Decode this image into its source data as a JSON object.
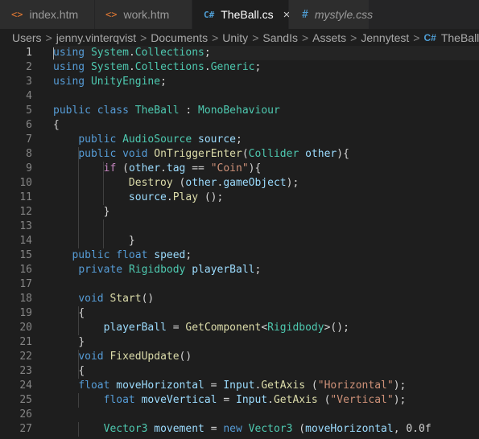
{
  "tabs": [
    {
      "icon": "<>",
      "label": "index.htm"
    },
    {
      "icon": "<>",
      "label": "work.htm"
    },
    {
      "icon": "C#",
      "label": "TheBall.cs",
      "close": "×"
    },
    {
      "icon": "#",
      "label": "mystyle.css"
    }
  ],
  "breadcrumb": {
    "items": [
      "Users",
      "jenny.vinterqvist",
      "Documents",
      "Unity",
      "SandIs",
      "Assets",
      "Jennytest"
    ],
    "file": "TheBall.cs"
  },
  "editor": {
    "line_numbers": [
      "1",
      "2",
      "3",
      "4",
      "5",
      "6",
      "7",
      "8",
      "9",
      "10",
      "11",
      "12",
      "13",
      "14",
      "15",
      "16",
      "17",
      "18",
      "19",
      "20",
      "21",
      "22",
      "23",
      "24",
      "25",
      "26",
      "27"
    ],
    "lines": [
      [
        "using",
        " ",
        "System",
        ".",
        "Collections",
        ";"
      ],
      [
        "using",
        " ",
        "System",
        ".",
        "Collections",
        ".",
        "Generic",
        ";"
      ],
      [
        "using",
        " ",
        "UnityEngine",
        ";"
      ],
      [],
      [
        "public",
        " ",
        "class",
        " ",
        "TheBall",
        " : ",
        "MonoBehaviour"
      ],
      [
        "{"
      ],
      [
        "    ",
        "public",
        " ",
        "AudioSource",
        " ",
        "source",
        ";"
      ],
      [
        "    ",
        "public",
        " ",
        "void",
        " ",
        "OnTriggerEnter",
        "(",
        "Collider",
        " ",
        "other",
        "){"
      ],
      [
        "        ",
        "if",
        " (",
        "other",
        ".",
        "tag",
        " == ",
        "\"Coin\"",
        "){"
      ],
      [
        "            ",
        "Destroy",
        " (",
        "other",
        ".",
        "gameObject",
        ");"
      ],
      [
        "            ",
        "source",
        ".",
        "Play",
        " ();"
      ],
      [
        "        ",
        "}"
      ],
      [],
      [
        "            ",
        "}"
      ],
      [
        "   ",
        "public",
        " ",
        "float",
        " ",
        "speed",
        ";"
      ],
      [
        "    ",
        "private",
        " ",
        "Rigidbody",
        " ",
        "playerBall",
        ";"
      ],
      [],
      [
        "    ",
        "void",
        " ",
        "Start",
        "()"
      ],
      [
        "    ",
        "{"
      ],
      [
        "        ",
        "playerBall",
        " = ",
        "GetComponent",
        "<",
        "Rigidbody",
        ">();"
      ],
      [
        "    ",
        "}"
      ],
      [
        "    ",
        "void",
        " ",
        "FixedUpdate",
        "()"
      ],
      [
        "    ",
        "{"
      ],
      [
        "    ",
        "float",
        " ",
        "moveHorizontal",
        " = ",
        "Input",
        ".",
        "GetAxis",
        " (",
        "\"Horizontal\"",
        ");"
      ],
      [
        "        ",
        "float",
        " ",
        "moveVertical",
        " = ",
        "Input",
        ".",
        "GetAxis",
        " (",
        "\"Vertical\"",
        ");"
      ],
      [],
      [
        "        ",
        "Vector3",
        " ",
        "movement",
        " = ",
        "new",
        " ",
        "Vector3",
        " (",
        "moveHorizontal",
        ", ",
        "0.0f"
      ]
    ],
    "token_kinds": [
      [
        "kw",
        "p",
        "ty",
        "p",
        "ty",
        "p"
      ],
      [
        "kw",
        "p",
        "ty",
        "p",
        "ty",
        "p",
        "ty",
        "p"
      ],
      [
        "kw",
        "p",
        "ty",
        "p"
      ],
      [],
      [
        "kw",
        "p",
        "kw",
        "p",
        "ty",
        "p",
        "ty"
      ],
      [
        "p"
      ],
      [
        "p",
        "kw",
        "p",
        "ty",
        "p",
        "vr",
        "p"
      ],
      [
        "p",
        "kw",
        "p",
        "kw",
        "p",
        "fn",
        "p",
        "ty",
        "p",
        "vr",
        "p"
      ],
      [
        "p",
        "ctl",
        "p",
        "vr",
        "p",
        "vr",
        "p",
        "st",
        "p"
      ],
      [
        "p",
        "fn",
        "p",
        "vr",
        "p",
        "vr",
        "p"
      ],
      [
        "p",
        "vr",
        "p",
        "fn",
        "p"
      ],
      [
        "p",
        "p"
      ],
      [],
      [
        "p",
        "p"
      ],
      [
        "p",
        "kw",
        "p",
        "kw",
        "p",
        "vr",
        "p"
      ],
      [
        "p",
        "kw",
        "p",
        "ty",
        "p",
        "vr",
        "p"
      ],
      [],
      [
        "p",
        "kw",
        "p",
        "fn",
        "p"
      ],
      [
        "p",
        "p"
      ],
      [
        "p",
        "vr",
        "p",
        "fn",
        "p",
        "ty",
        "p"
      ],
      [
        "p",
        "p"
      ],
      [
        "p",
        "kw",
        "p",
        "fn",
        "p"
      ],
      [
        "p",
        "p"
      ],
      [
        "p",
        "kw",
        "p",
        "vr",
        "p",
        "vr",
        "p",
        "fn",
        "p",
        "st",
        "p"
      ],
      [
        "p",
        "kw",
        "p",
        "vr",
        "p",
        "vr",
        "p",
        "fn",
        "p",
        "st",
        "p"
      ],
      [],
      [
        "p",
        "ty",
        "p",
        "vr",
        "p",
        "kw",
        "p",
        "ty",
        "p",
        "vr",
        "p",
        "p"
      ]
    ],
    "current_line": 1
  }
}
